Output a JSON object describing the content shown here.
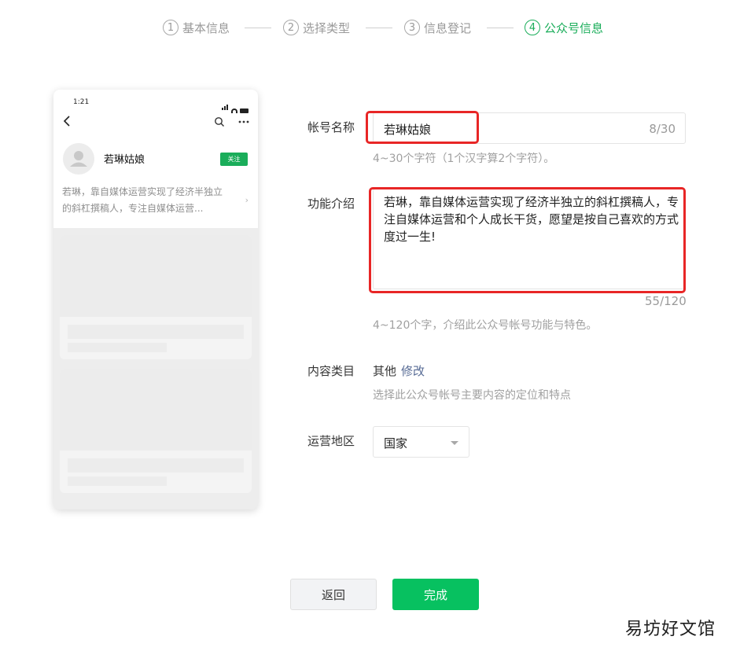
{
  "stepper": {
    "steps": [
      {
        "num": "1",
        "label": "基本信息"
      },
      {
        "num": "2",
        "label": "选择类型"
      },
      {
        "num": "3",
        "label": "信息登记"
      },
      {
        "num": "4",
        "label": "公众号信息"
      }
    ],
    "active_step": 4
  },
  "preview": {
    "time": "1:21",
    "account_name": "若琳姑娘",
    "follow_label": "关注",
    "description_lines": [
      "若琳，靠自媒体运营实现了经济半独立",
      "的斜杠撰稿人，专注自媒体运营..."
    ]
  },
  "form": {
    "name": {
      "label": "帐号名称",
      "value": "若琳姑娘",
      "count": "8/30",
      "hint": "4~30个字符（1个汉字算2个字符）。"
    },
    "intro": {
      "label": "功能介绍",
      "value": "若琳，靠自媒体运营实现了经济半独立的斜杠撰稿人，专注自媒体运营和个人成长干货，愿望是按自己喜欢的方式度过一生!",
      "count": "55/120",
      "hint": "4~120个字，介绍此公众号帐号功能与特色。"
    },
    "category": {
      "label": "内容类目",
      "value": "其他",
      "edit": "修改",
      "hint": "选择此公众号帐号主要内容的定位和特点"
    },
    "region": {
      "label": "运营地区",
      "value": "国家"
    }
  },
  "buttons": {
    "back": "返回",
    "done": "完成"
  },
  "watermark": "易坊好文馆",
  "colors": {
    "accent": "#1aad5a",
    "primary_button": "#07c160",
    "highlight": "#e82626",
    "link": "#576b95"
  }
}
